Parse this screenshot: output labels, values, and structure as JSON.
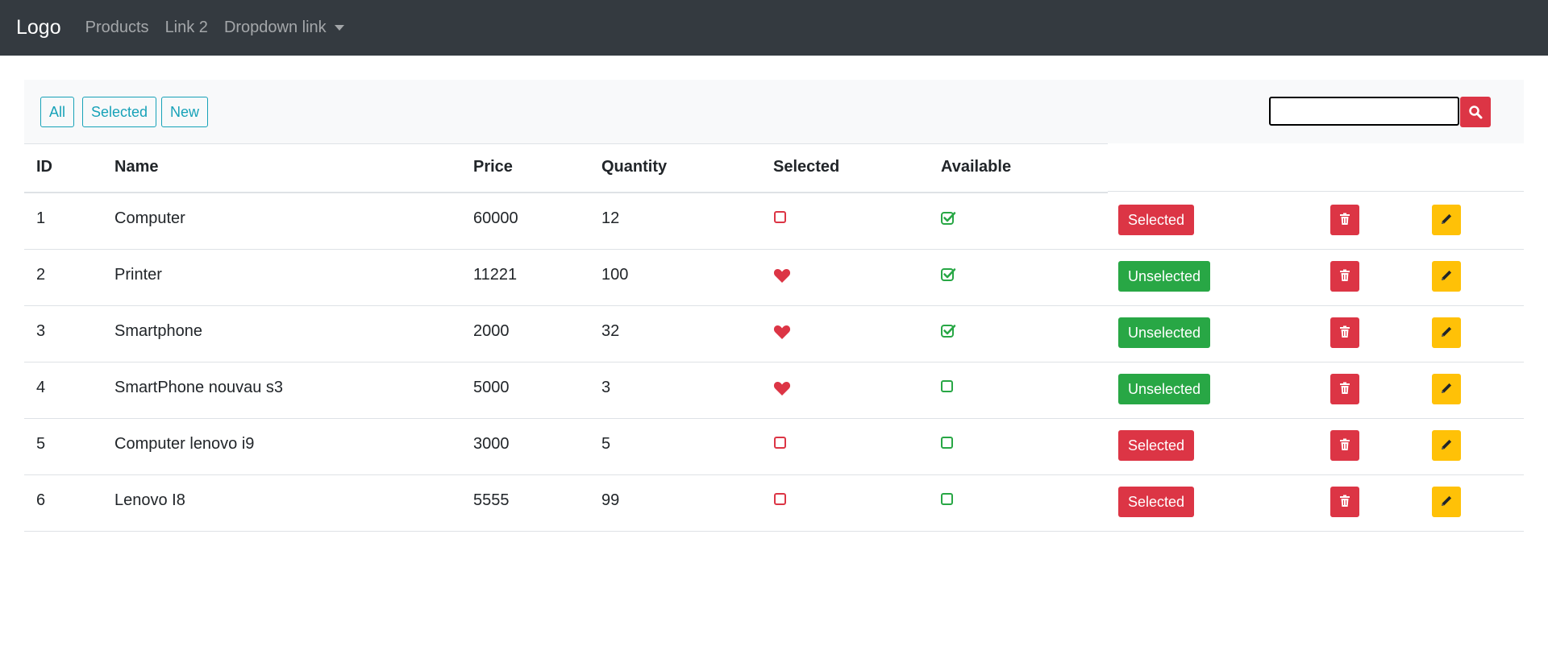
{
  "navbar": {
    "brand": "Logo",
    "links": [
      "Products",
      "Link 2",
      "Dropdown link"
    ]
  },
  "filters": [
    "All",
    "Selected",
    "New"
  ],
  "search": {
    "value": "",
    "icon": "search-icon"
  },
  "table": {
    "headers": [
      "ID",
      "Name",
      "Price",
      "Quantity",
      "Selected",
      "Available"
    ],
    "rows": [
      {
        "id": "1",
        "name": "Computer",
        "price": "60000",
        "quantity": "12",
        "selected": false,
        "available": true,
        "status_label": "Selected"
      },
      {
        "id": "2",
        "name": "Printer",
        "price": "11221",
        "quantity": "100",
        "selected": true,
        "available": true,
        "status_label": "Unselected"
      },
      {
        "id": "3",
        "name": "Smartphone",
        "price": "2000",
        "quantity": "32",
        "selected": true,
        "available": true,
        "status_label": "Unselected"
      },
      {
        "id": "4",
        "name": "SmartPhone nouvau s3",
        "price": "5000",
        "quantity": "3",
        "selected": true,
        "available": false,
        "status_label": "Unselected"
      },
      {
        "id": "5",
        "name": "Computer lenovo i9",
        "price": "3000",
        "quantity": "5",
        "selected": false,
        "available": false,
        "status_label": "Selected"
      },
      {
        "id": "6",
        "name": "Lenovo I8",
        "price": "5555",
        "quantity": "99",
        "selected": false,
        "available": false,
        "status_label": "Selected"
      }
    ]
  },
  "colors": {
    "navbar": "#343a40",
    "info": "#17a2b8",
    "danger": "#dc3545",
    "success": "#28a745",
    "warning": "#ffc107"
  },
  "icons": {
    "selected_true": "heart-icon",
    "selected_false": "square-icon",
    "available_true": "check-square-icon",
    "available_false": "square-icon",
    "delete": "trash-icon",
    "edit": "pencil-icon"
  }
}
